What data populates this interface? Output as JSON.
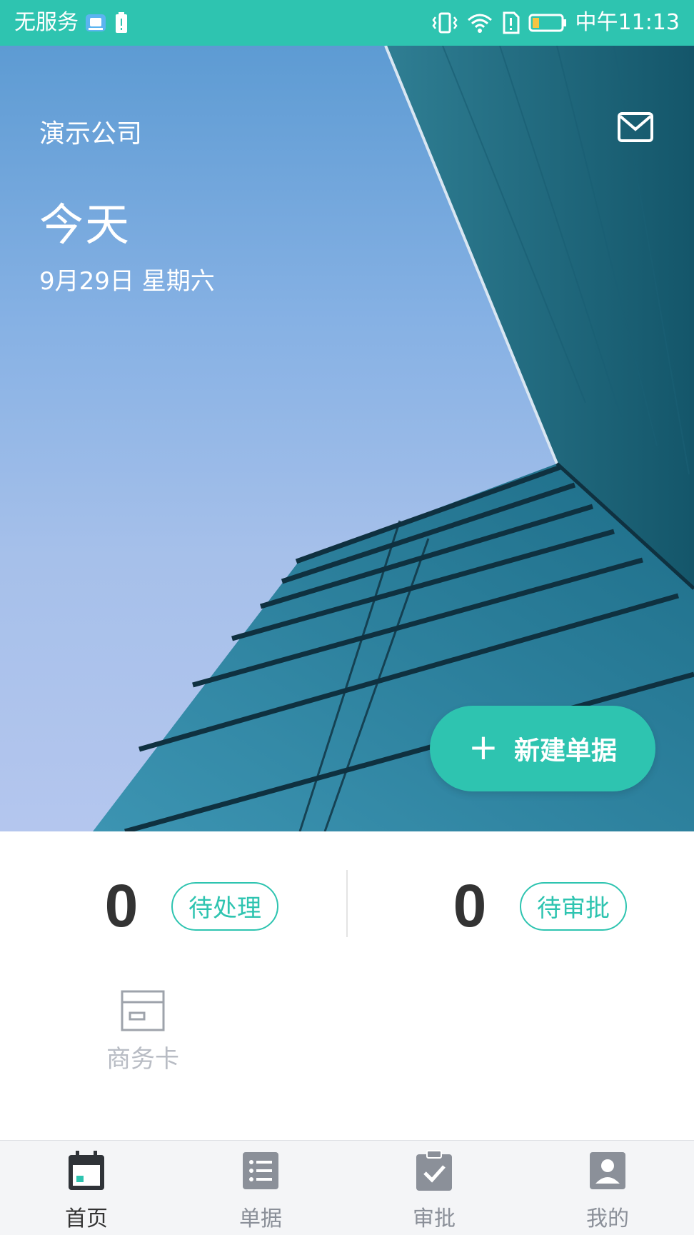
{
  "status_bar": {
    "carrier": "无服务",
    "time": "中午11:13",
    "icons": [
      "app-notification-icon",
      "battery-alert-icon",
      "vibrate-icon",
      "wifi-icon",
      "alert-icon",
      "battery-icon"
    ]
  },
  "header": {
    "company": "演示公司",
    "mail_icon": "mail-icon",
    "today_label": "今天",
    "date": "9月29日 星期六"
  },
  "new_button": {
    "label": "新建单据",
    "icon": "plus-icon"
  },
  "stats": [
    {
      "count": "0",
      "label": "待处理"
    },
    {
      "count": "0",
      "label": "待审批"
    }
  ],
  "shortcuts": [
    {
      "label": "商务卡",
      "icon": "card-icon"
    }
  ],
  "tabs": [
    {
      "label": "首页",
      "icon": "calendar-icon",
      "active": true
    },
    {
      "label": "单据",
      "icon": "list-icon",
      "active": false
    },
    {
      "label": "审批",
      "icon": "clipboard-check-icon",
      "active": false
    },
    {
      "label": "我的",
      "icon": "person-icon",
      "active": false
    }
  ],
  "colors": {
    "accent": "#2ec4b0",
    "text_dark": "#333333",
    "muted": "#8b9099"
  }
}
